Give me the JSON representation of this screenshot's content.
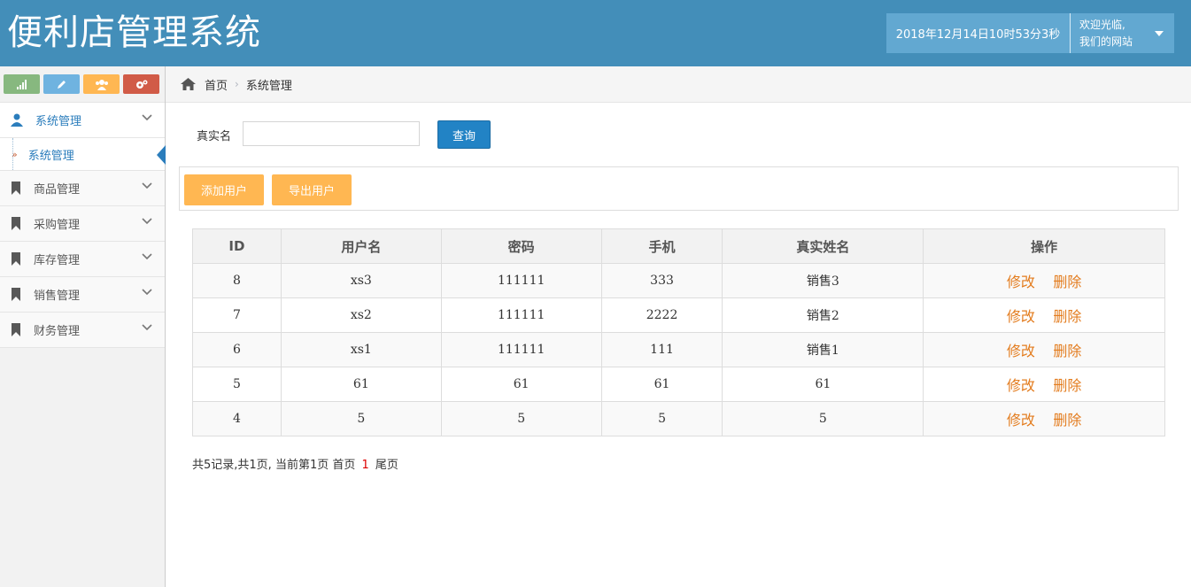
{
  "app": {
    "title": "便利店管理系统"
  },
  "header": {
    "datetime": "2018年12月14日10时53分3秒",
    "welcome_line1": "欢迎光临,",
    "welcome_line2": "我们的网站"
  },
  "sidebar": {
    "shortcuts": [
      {
        "icon": "signal-icon",
        "color": "#87b87f"
      },
      {
        "icon": "pencil-icon",
        "color": "#6fb3e0"
      },
      {
        "icon": "users-icon",
        "color": "#ffb752"
      },
      {
        "icon": "cogs-icon",
        "color": "#d15b47"
      }
    ],
    "active_menu": "系统管理",
    "active_sub": "系统管理",
    "items": [
      {
        "label": "商品管理",
        "icon": "bookmark-icon"
      },
      {
        "label": "采购管理",
        "icon": "bookmark-icon"
      },
      {
        "label": "库存管理",
        "icon": "bookmark-icon"
      },
      {
        "label": "销售管理",
        "icon": "bookmark-icon"
      },
      {
        "label": "财务管理",
        "icon": "bookmark-icon"
      }
    ]
  },
  "breadcrumb": {
    "home": "首页",
    "current": "系统管理"
  },
  "search": {
    "label": "真实名",
    "value": "",
    "button": "查询"
  },
  "toolbar": {
    "add": "添加用户",
    "export": "导出用户"
  },
  "table": {
    "headers": [
      "ID",
      "用户名",
      "密码",
      "手机",
      "真实姓名",
      "操作"
    ],
    "rows": [
      [
        "8",
        "xs3",
        "111111",
        "333",
        "销售3"
      ],
      [
        "7",
        "xs2",
        "111111",
        "2222",
        "销售2"
      ],
      [
        "6",
        "xs1",
        "111111",
        "111",
        "销售1"
      ],
      [
        "5",
        "61",
        "61",
        "61",
        "61"
      ],
      [
        "4",
        "5",
        "5",
        "5",
        "5"
      ]
    ],
    "edit_label": "修改",
    "delete_label": "删除"
  },
  "pager": {
    "summary": "共5记录,共1页, 当前第1页 首页",
    "current": "1",
    "last": "尾页"
  },
  "colors": {
    "header": "#438eb9",
    "accent_orange": "#ffb752",
    "primary_blue": "#2283c5",
    "action_orange": "#e37c1e"
  }
}
